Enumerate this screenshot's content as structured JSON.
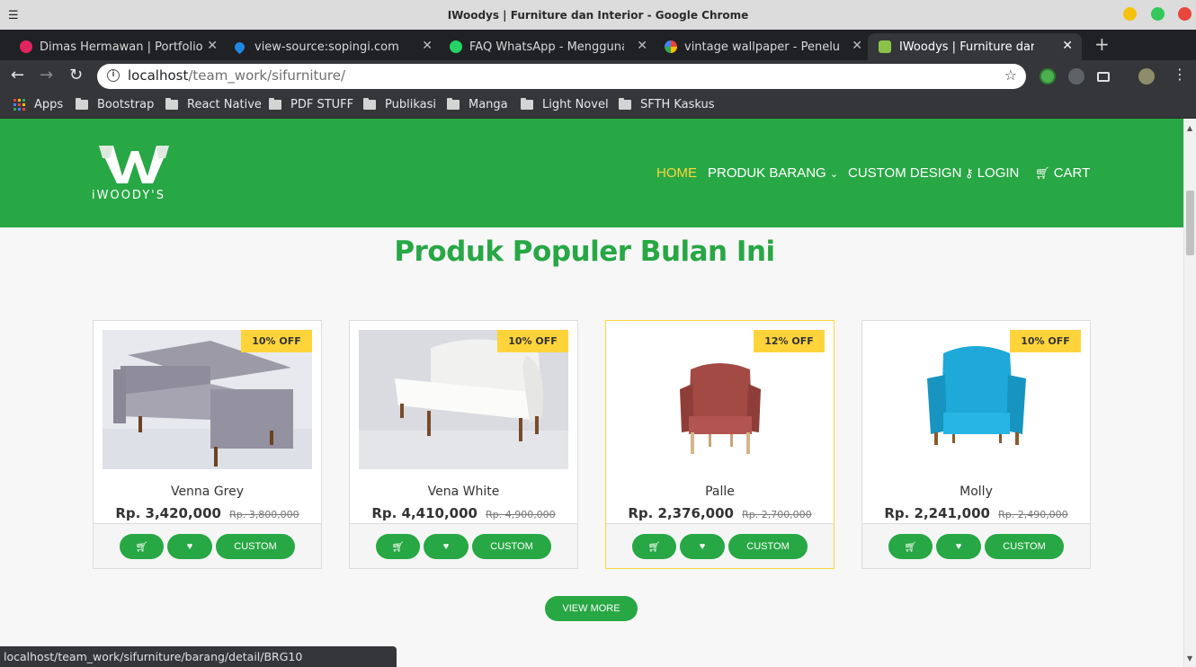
{
  "window": {
    "title": "IWoodys | Furniture dan Interior - Google Chrome",
    "menu_icon": "☰"
  },
  "tabs": [
    {
      "label": "Dimas Hermawan | Portfolio",
      "icon": "portfolio-favicon",
      "color": "#e0245e"
    },
    {
      "label": "view-source:sopingi.com",
      "icon": "drop-favicon",
      "color": "#1e88e5"
    },
    {
      "label": "FAQ WhatsApp - Menggunak",
      "icon": "whatsapp-favicon",
      "color": "#25d366"
    },
    {
      "label": "vintage wallpaper - Penelusur",
      "icon": "google-favicon",
      "color": "#4285f4"
    },
    {
      "label": "IWoodys | Furniture dan Inter",
      "icon": "iwoodys-favicon",
      "color": "#8bc34a"
    }
  ],
  "address": {
    "host": "localhost",
    "path": "/team_work/sifurniture/"
  },
  "bookmarks": [
    "Apps",
    "Bootstrap",
    "React Native",
    "PDF STUFF",
    "Publikasi",
    "Manga",
    "Light Novel",
    "SFTH Kaskus"
  ],
  "site": {
    "logo_text": "iWOODY'S",
    "nav": {
      "home": "HOME",
      "produk": "PRODUK BARANG",
      "custom": "CUSTOM DESIGN",
      "login": "LOGIN",
      "cart": "CART"
    },
    "heading": "Produk Populer Bulan Ini",
    "view_more": "VIEW MORE",
    "custom_label": "CUSTOM",
    "brand_color": "#28a745",
    "accent_color": "#ffd43b"
  },
  "products": [
    {
      "name": "Venna Grey",
      "price": "Rp. 3,420,000",
      "old_price": "Rp. 3,800,000",
      "badge": "10% OFF",
      "image": "grey-sofa"
    },
    {
      "name": "Vena White",
      "price": "Rp. 4,410,000",
      "old_price": "Rp. 4,900,000",
      "badge": "10% OFF",
      "image": "white-sofa"
    },
    {
      "name": "Palle",
      "price": "Rp. 2,376,000",
      "old_price": "Rp. 2,700,000",
      "badge": "12% OFF",
      "image": "red-armchair"
    },
    {
      "name": "Molly",
      "price": "Rp. 2,241,000",
      "old_price": "Rp. 2,490,000",
      "badge": "10% OFF",
      "image": "blue-armchair"
    }
  ],
  "status": "localhost/team_work/sifurniture/barang/detail/BRG10"
}
